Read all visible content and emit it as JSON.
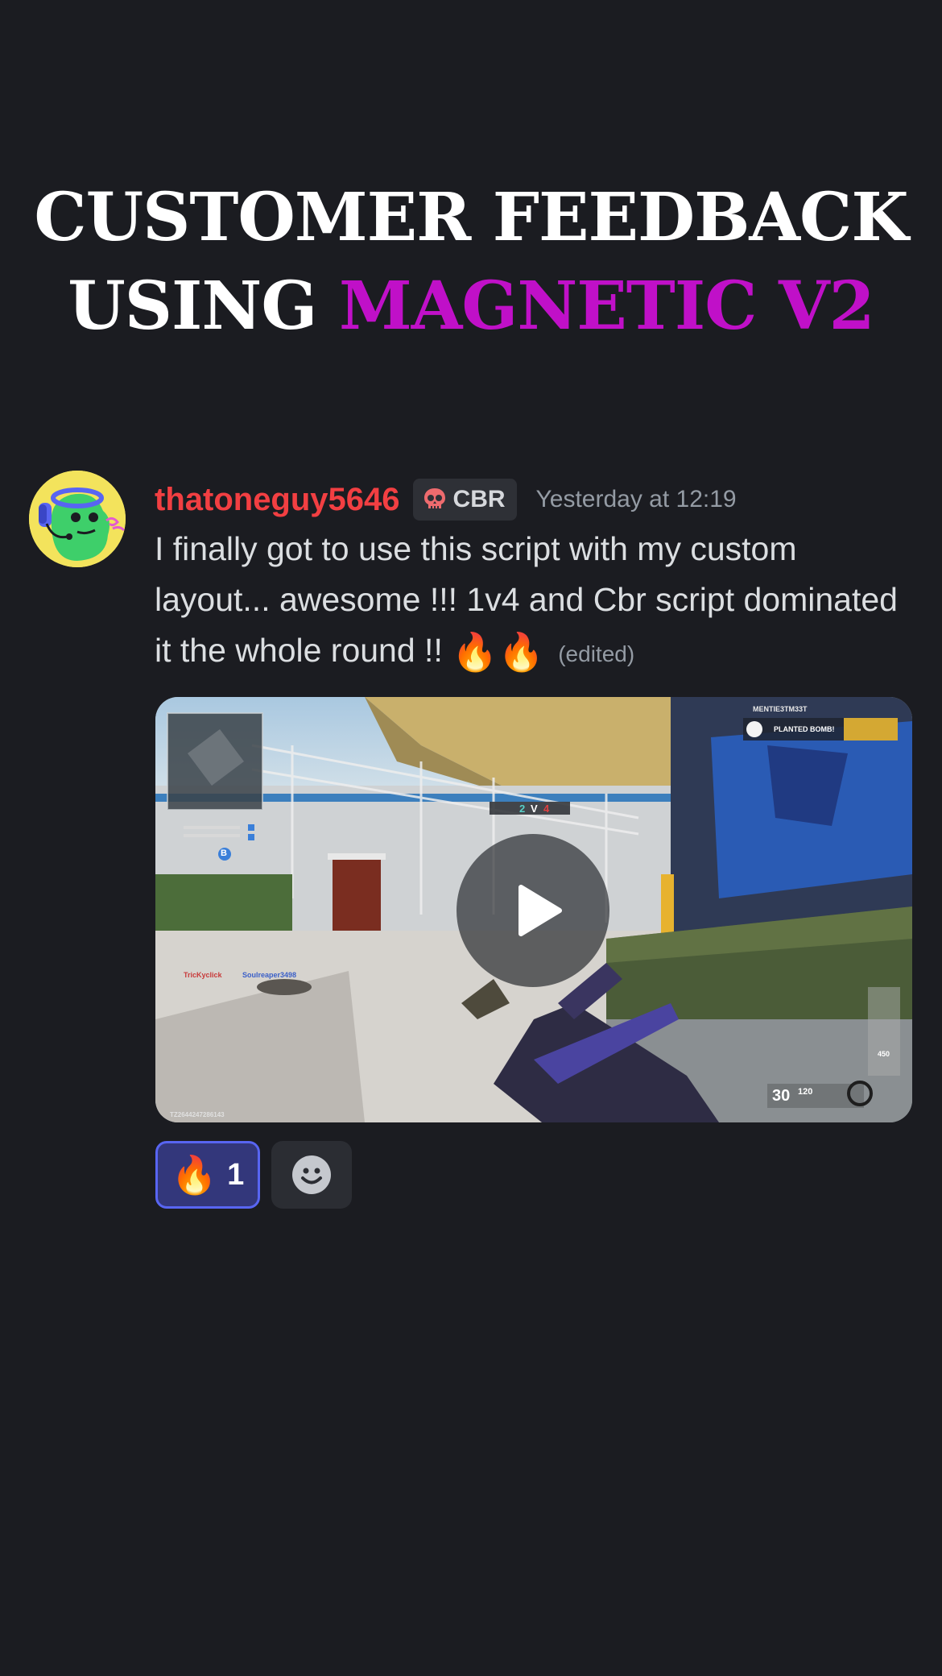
{
  "headline": {
    "line1": "CUSTOMER FEEDBACK",
    "line2_plain": "USING",
    "line2_accent": "MAGNETIC V2",
    "accent_color": "#c010c8"
  },
  "message": {
    "username": "thatoneguy5646",
    "username_color": "#f23f42",
    "tag": {
      "icon": "skull-icon",
      "label": "CBR"
    },
    "timestamp": "Yesterday at 12:19",
    "text_part1": "I finally got to use this script with my custom layout... awesome !!! 1v4  and Cbr script dominated it the whole round !!",
    "emoji1": "🔥",
    "emoji2": "🔥",
    "edited_label": "(edited)"
  },
  "video": {
    "play_icon": "play-icon",
    "hud": {
      "score_left": "2",
      "score_sep": "V",
      "score_right": "4",
      "killfeed_name": "MENTIE3TM33T",
      "killfeed_event": "PLANTED BOMB!",
      "player1": "TricKyclick",
      "player2": "Soulreaper3498",
      "ammo": "30",
      "ammo_reserve": "120",
      "side_count": "450",
      "bottom_id": "TZ2644247286143",
      "objective": "B"
    }
  },
  "reactions": [
    {
      "emoji": "🔥",
      "count": "1",
      "selected": true
    },
    {
      "icon": "add-reaction-icon"
    }
  ]
}
